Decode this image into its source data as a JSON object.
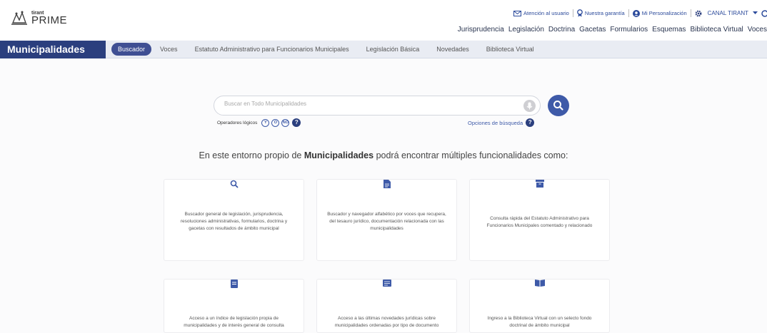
{
  "logo": {
    "small": "tirant",
    "big": "PRIME"
  },
  "utility": {
    "atencion": "Atención al usuario",
    "garantia": "Nuestra garantía",
    "personalizacion": "Mi Personalización",
    "canal": "CANAL TIRANT"
  },
  "topnav": [
    "Jurisprudencia",
    "Legislación",
    "Doctrina",
    "Gacetas",
    "Formularios",
    "Esquemas",
    "Biblioteca Virtual",
    "Voces"
  ],
  "brand": "Municipalidades",
  "subnav": {
    "active": "Buscador",
    "items": [
      "Voces",
      "Estatuto Administrativo para Funcionarios Municipales",
      "Legislación Básica",
      "Novedades",
      "Biblioteca Virtual"
    ]
  },
  "search": {
    "placeholder": "Buscar en Todo Municipalidades",
    "operators_label": "Operadores lógicos",
    "operators": [
      "Y",
      "O",
      "NO"
    ],
    "options_label": "Opciones de búsqueda"
  },
  "intro": {
    "before": "En este entorno propio de ",
    "bold": "Municipalidades",
    "after": " podrá encontrar múltiples funcionalidades como:"
  },
  "cards": [
    {
      "icon": "search-icon",
      "text": "Buscador general de legislación, jurisprudencia, resoluciones administrativas, formularios, doctrina y gacetas con resultados de ámbito municipal"
    },
    {
      "icon": "document-icon",
      "text": "Buscador y navegador alfabético por voces que recupera, del tesauro jurídico, documentación relacionada con las municipalidades"
    },
    {
      "icon": "archive-icon",
      "text": "Consulta rápida del Estatuto Administrativo para Funcionarios Municipales comentado y relacionado"
    },
    {
      "icon": "book-icon",
      "text": "Acceso a un índice de legislación propia de municipalidades y de interés general de consulta"
    },
    {
      "icon": "newspaper-icon",
      "text": "Acceso a las últimas novedades jurídicas sobre municipalidades ordenadas por tipo de documento"
    },
    {
      "icon": "open-book-icon",
      "text": "Ingreso a la Biblioteca Virtual con un selecto fondo doctrinal de ámbito municipal"
    }
  ],
  "colors": {
    "brand": "#2b3f7e",
    "accent": "#3e5aa8",
    "bar": "#e9ecf3"
  }
}
